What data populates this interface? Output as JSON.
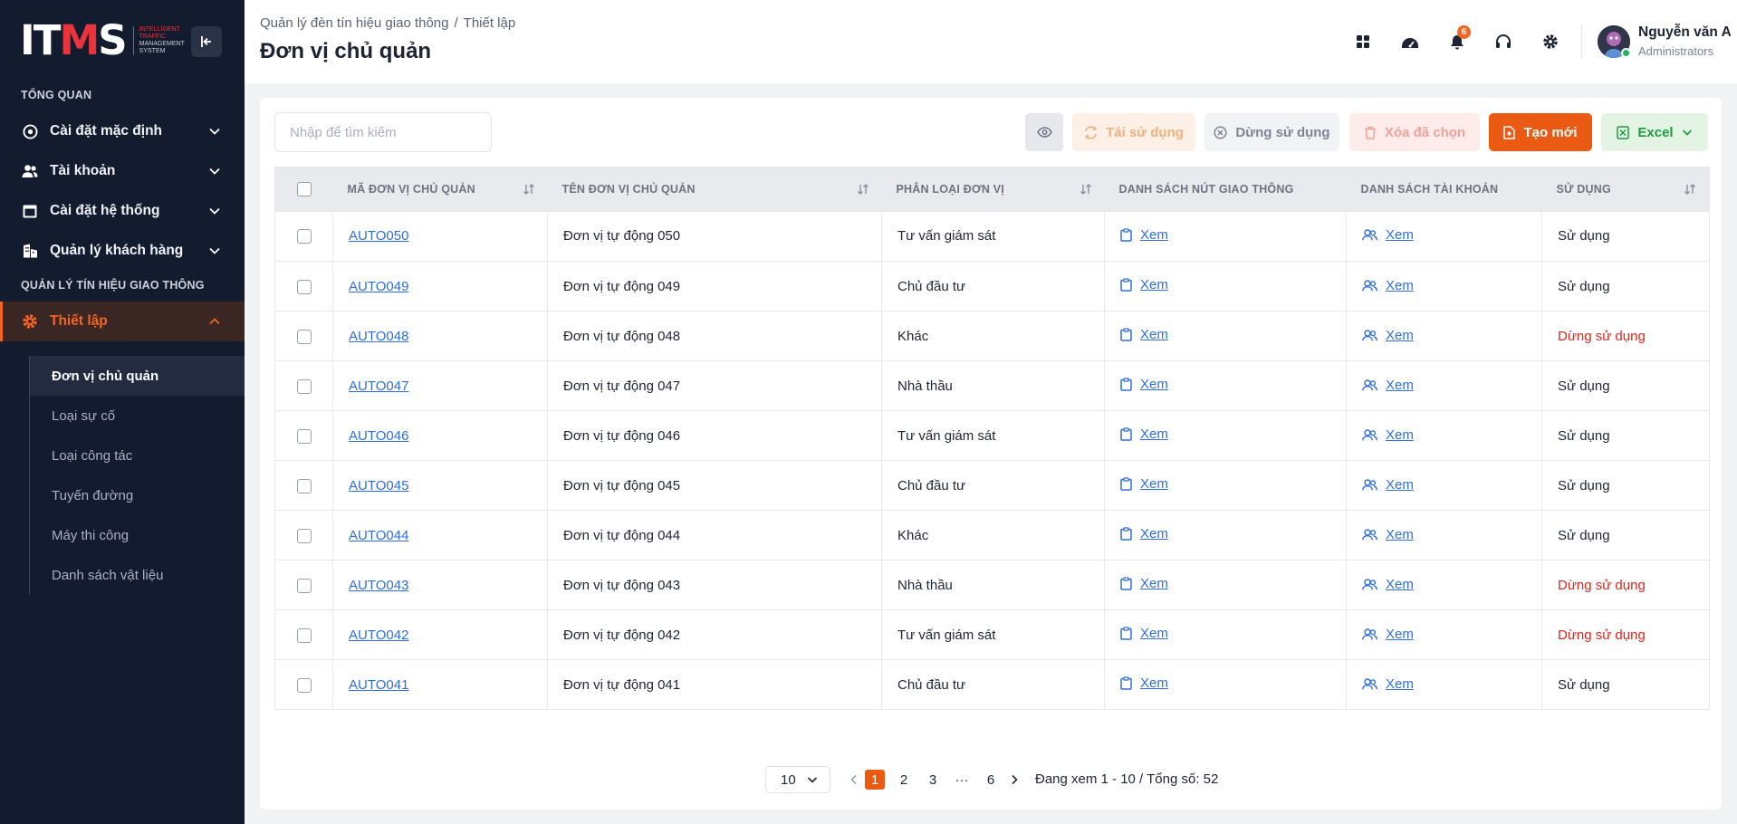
{
  "logo": {
    "mark": "ITMS",
    "sub_line1": "INTELLIGENT",
    "sub_line2": "TRAFFIC",
    "sub_line3": "MANAGEMENT",
    "sub_line4": "SYSTEM"
  },
  "sidebar": {
    "section_overview": "TỔNG QUAN",
    "items": [
      {
        "label": "Cài đặt mặc định",
        "icon": "gear-circle-icon"
      },
      {
        "label": "Tài khoản",
        "icon": "users-icon"
      },
      {
        "label": "Cài đặt hệ thống",
        "icon": "window-icon"
      },
      {
        "label": "Quản lý khách hàng",
        "icon": "building-icon"
      }
    ],
    "section_traffic": "QUẢN LÝ TÍN HIỆU GIAO THÔNG",
    "active_item": {
      "label": "Thiết lập",
      "icon": "gear-icon"
    },
    "submenu": [
      "Đơn vị chủ quản",
      "Loại sự cố",
      "Loại công tác",
      "Tuyến đường",
      "Máy thi công",
      "Danh sách vật liệu"
    ]
  },
  "header": {
    "breadcrumb_root": "Quản lý đèn tín hiệu giao thông",
    "breadcrumb_sep": "/",
    "breadcrumb_current": "Thiết lập",
    "title": "Đơn vị chủ quản",
    "notification_count": "6",
    "user_name": "Nguyễn văn A",
    "user_role": "Administrators"
  },
  "toolbar": {
    "search_placeholder": "Nhập để tìm kiếm",
    "reuse_label": "Tái sử dụng",
    "stop_label": "Dừng sử dụng",
    "delete_label": "Xóa đã chọn",
    "create_label": "Tạo mới",
    "excel_label": "Excel"
  },
  "table": {
    "columns": [
      "MÃ ĐƠN VỊ CHỦ QUẢN",
      "TÊN ĐƠN VỊ CHỦ QUẢN",
      "PHÂN LOẠI ĐƠN VỊ",
      "DANH SÁCH NÚT GIAO THÔNG",
      "DANH SÁCH TÀI KHOẢN",
      "SỬ DỤNG"
    ],
    "view_label": "Xem",
    "rows": [
      {
        "code": "AUTO050",
        "name": "Đơn vị tự động 050",
        "type": "Tư vấn giám sát",
        "status": "Sử dụng",
        "active": true
      },
      {
        "code": "AUTO049",
        "name": "Đơn vị tự động 049",
        "type": "Chủ đầu tư",
        "status": "Sử dụng",
        "active": true
      },
      {
        "code": "AUTO048",
        "name": "Đơn vị tự động 048",
        "type": "Khác",
        "status": "Dừng sử dụng",
        "active": false
      },
      {
        "code": "AUTO047",
        "name": "Đơn vị tự động 047",
        "type": "Nhà thầu",
        "status": "Sử dụng",
        "active": true
      },
      {
        "code": "AUTO046",
        "name": "Đơn vị tự động 046",
        "type": "Tư vấn giám sát",
        "status": "Sử dụng",
        "active": true
      },
      {
        "code": "AUTO045",
        "name": "Đơn vị tự động 045",
        "type": "Chủ đầu tư",
        "status": "Sử dụng",
        "active": true
      },
      {
        "code": "AUTO044",
        "name": "Đơn vị tự động 044",
        "type": "Khác",
        "status": "Sử dụng",
        "active": true
      },
      {
        "code": "AUTO043",
        "name": "Đơn vị tự động 043",
        "type": "Nhà thầu",
        "status": "Dừng sử dụng",
        "active": false
      },
      {
        "code": "AUTO042",
        "name": "Đơn vị tự động 042",
        "type": "Tư vấn giám sát",
        "status": "Dừng sử dụng",
        "active": false
      },
      {
        "code": "AUTO041",
        "name": "Đơn vị tự động 041",
        "type": "Chủ đầu tư",
        "status": "Sử dụng",
        "active": true
      }
    ]
  },
  "pagination": {
    "page_size": "10",
    "pages": [
      "1",
      "2",
      "3",
      "6"
    ],
    "ellipsis": "···",
    "current": "1",
    "info": "Đang xem 1 - 10 / Tổng số: 52"
  },
  "colors": {
    "accent": "#eb5a12",
    "sidebar_bg": "#131b2e",
    "link": "#2f6ee0",
    "danger": "#e0251b",
    "excel": "#1f9a3c"
  }
}
